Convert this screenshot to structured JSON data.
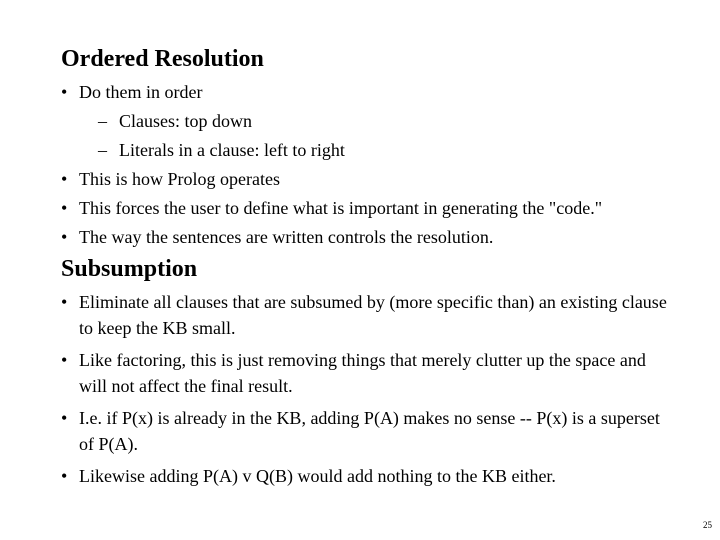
{
  "slide": {
    "sections": [
      {
        "title": "Ordered Resolution",
        "items": [
          {
            "level": 1,
            "marker": "•",
            "text": "Do them in order"
          },
          {
            "level": 2,
            "marker": "–",
            "text": "Clauses: top down"
          },
          {
            "level": 2,
            "marker": "–",
            "text": "Literals in a clause: left to right"
          },
          {
            "level": 1,
            "marker": "•",
            "text": "This is how Prolog operates"
          },
          {
            "level": 1,
            "marker": "•",
            "text": "This forces the user to define what is important in generating the \"code.\""
          },
          {
            "level": 1,
            "marker": "•",
            "text": "The way the sentences are written controls the resolution."
          }
        ]
      },
      {
        "title": "Subsumption",
        "items": [
          {
            "level": 1,
            "marker": "•",
            "text": "Eliminate all clauses that are subsumed by (more specific than) an existing clause to keep the KB small."
          },
          {
            "level": 1,
            "marker": "•",
            "text": "Like factoring, this is just removing things that merely clutter up the space and will not affect the final result."
          },
          {
            "level": 1,
            "marker": "•",
            "text": "I.e. if P(x) is already in the KB, adding P(A) makes no sense -- P(x) is a superset of P(A)."
          },
          {
            "level": 1,
            "marker": "•",
            "text": "Likewise adding P(A) v Q(B) would add nothing to the KB either."
          }
        ]
      }
    ],
    "page_number": "25"
  }
}
